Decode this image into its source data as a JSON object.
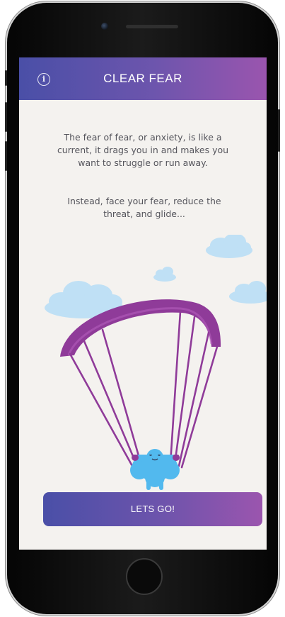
{
  "header": {
    "title": "CLEAR FEAR",
    "info_icon": "info-icon"
  },
  "content": {
    "paragraph_1": "The fear of fear, or anxiety, is like a current, it drags you in and makes you want to struggle or run away.",
    "paragraph_2": "Instead, face your fear, reduce the threat, and glide..."
  },
  "illustration": {
    "description_icon": "paraglider-illustration",
    "cloud_color": "#bfe0f5",
    "canopy_color": "#9b3fa0",
    "character_color": "#52b9ee"
  },
  "cta": {
    "label": "LETS GO!"
  },
  "colors": {
    "gradient_start": "#4a4fa7",
    "gradient_end": "#9b55ae",
    "background": "#f4f2ef",
    "text": "#55555c"
  }
}
